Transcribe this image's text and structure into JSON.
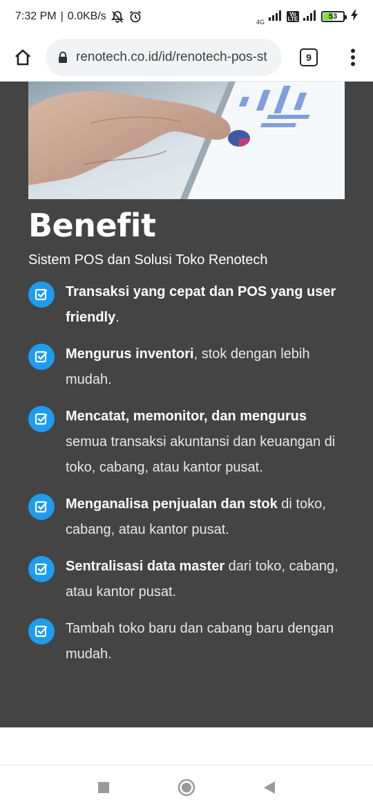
{
  "status_bar": {
    "time": "7:32 PM",
    "separator": "|",
    "speed": "0.0KB/s",
    "network": "4G",
    "volte": "Vo LTE",
    "battery": "53",
    "battery_level": 0.53
  },
  "browser": {
    "url": "renotech.co.id/id/renotech-pos-st",
    "tab_count": "9"
  },
  "page": {
    "title": "Benefit",
    "subtitle": "Sistem POS dan Solusi Toko Renotech",
    "items": [
      {
        "bold": "Transaksi yang cepat dan POS yang user friendly",
        "rest": "."
      },
      {
        "bold": "Mengurus inventori",
        "rest": ", stok dengan lebih mudah."
      },
      {
        "bold": "Mencatat, memonitor, dan mengurus",
        "rest": " semua transaksi akuntansi dan keuangan di toko, cabang, atau kantor pusat."
      },
      {
        "bold": "Menganalisa penjualan dan stok",
        "rest": " di toko, cabang, atau kantor pusat."
      },
      {
        "bold": "Sentralisasi data master",
        "rest": " dari toko, cabang, atau kantor pusat."
      },
      {
        "bold": "",
        "rest": "Tambah toko baru dan cabang baru dengan mudah."
      }
    ]
  },
  "colors": {
    "section_bg": "#444444",
    "check_bg": "#1e9cf0",
    "battery_fill": "#7ee03f"
  },
  "icons": {
    "home": "home-icon",
    "lock": "lock-icon",
    "menu": "more-vert-icon",
    "check": "checkbox-icon",
    "nav_recents": "square-icon",
    "nav_home": "circle-icon",
    "nav_back": "triangle-back-icon"
  }
}
